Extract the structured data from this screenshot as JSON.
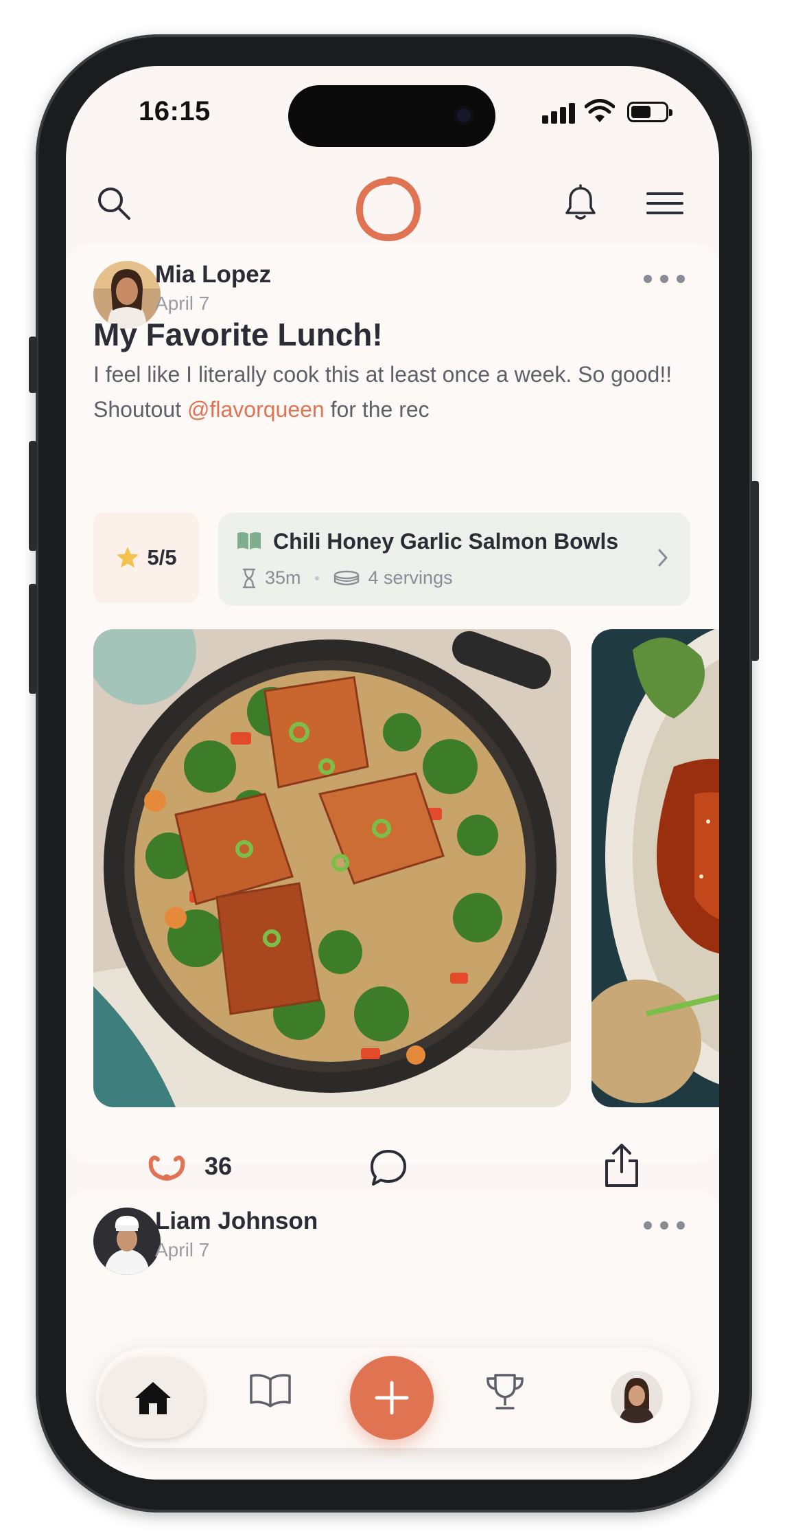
{
  "status_bar": {
    "time": "16:15"
  },
  "colors": {
    "accent": "#e07352",
    "background": "#fbf6f3",
    "text": "#2b2c36",
    "muted": "#9a9aa1",
    "recipe_bg": "#eef0eb",
    "book_icon": "#7fae8e",
    "star": "#f2c14e"
  },
  "appbar": {
    "search_icon": "search-icon",
    "logo": "app-logo-ring",
    "bell_icon": "bell-icon",
    "menu_icon": "hamburger-menu-icon"
  },
  "posts": [
    {
      "author": "Mia Lopez",
      "date": "April 7",
      "title": "My Favorite Lunch!",
      "text_before": "I feel like I literally cook this at least once a week. So good!! Shoutout ",
      "mention": "@flavorqueen",
      "text_after": " for the rec",
      "rating": "5/5",
      "recipe": {
        "name": "Chili Honey Garlic Salmon Bowls",
        "time": "35m",
        "servings": "4 servings"
      },
      "likes": "36"
    },
    {
      "author": "Liam Johnson",
      "date": "April 7"
    }
  ],
  "bottom_nav": {
    "items": [
      "home-icon",
      "book-icon",
      "add-icon",
      "trophy-icon",
      "profile-avatar"
    ],
    "active": "home-icon"
  }
}
